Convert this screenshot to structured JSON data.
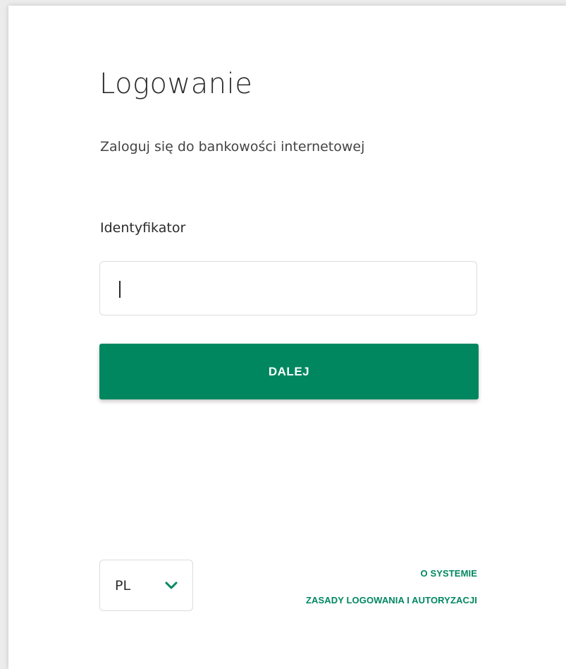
{
  "login": {
    "title": "Logowanie",
    "subtitle": "Zaloguj się do bankowości internetowej",
    "identifier_label": "Identyfikator",
    "identifier_value": "",
    "next_button": "DALEJ"
  },
  "footer": {
    "language_selected": "PL",
    "language_icon": "chevron-down-icon",
    "links": [
      {
        "label": "O SYSTEMIE"
      },
      {
        "label": "ZASADY LOGOWANIA I AUTORYZACJI"
      }
    ]
  },
  "colors": {
    "accent": "#00875f",
    "text": "#2b2b2b",
    "border": "#dddddd"
  }
}
